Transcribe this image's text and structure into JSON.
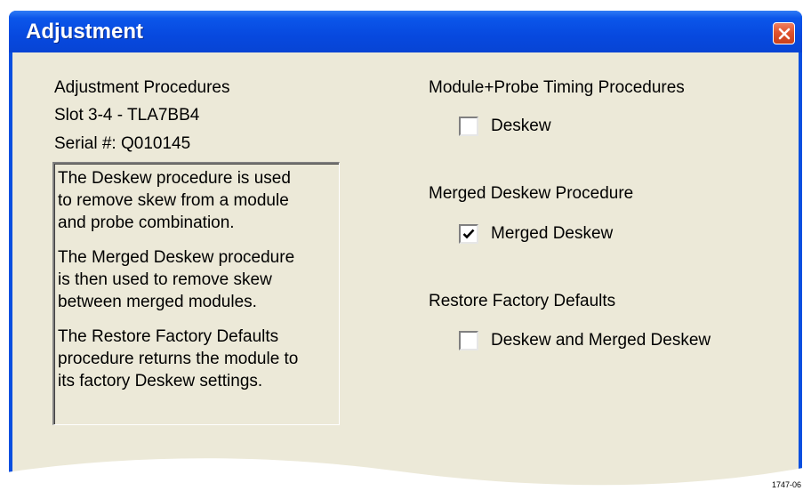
{
  "window": {
    "title": "Adjustment",
    "close_icon": "close-icon"
  },
  "left_panel": {
    "heading": "Adjustment Procedures",
    "slot": "Slot 3-4 - TLA7BB4",
    "serial": "Serial #: Q010145",
    "description": [
      "The Deskew procedure is used\nto remove skew from a module\nand probe combination.",
      "The Merged Deskew procedure\nis then used to remove skew\nbetween merged modules.",
      "The Restore Factory Defaults\nprocedure returns the module to\nits factory Deskew settings."
    ]
  },
  "right_panel": {
    "groups": [
      {
        "heading": "Module+Probe Timing Procedures",
        "option_label": "Deskew",
        "checked": false
      },
      {
        "heading": "Merged Deskew Procedure",
        "option_label": "Merged Deskew",
        "checked": true
      },
      {
        "heading": "Restore Factory Defaults",
        "option_label": "Deskew and Merged Deskew",
        "checked": false
      }
    ]
  },
  "figure_id": "1747-06",
  "colors": {
    "title_bar": "#0749df",
    "client_bg": "#ece9d8",
    "close_button": "#e0532e"
  }
}
